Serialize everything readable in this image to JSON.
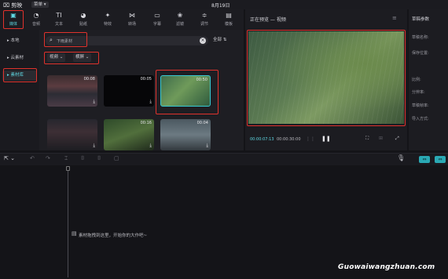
{
  "titlebar": {
    "app_name": "剪映",
    "menu_label": "菜单",
    "menu_arrow": "▾",
    "date": "8月19日"
  },
  "toolbar": {
    "items": [
      {
        "label": "媒体",
        "icon": "media-icon",
        "glyph": "▣"
      },
      {
        "label": "音频",
        "icon": "audio-icon",
        "glyph": "◔"
      },
      {
        "label": "文本",
        "icon": "text-icon",
        "glyph": "TI"
      },
      {
        "label": "贴纸",
        "icon": "sticker-icon",
        "glyph": "◕"
      },
      {
        "label": "特效",
        "icon": "effects-icon",
        "glyph": "✦"
      },
      {
        "label": "转场",
        "icon": "transition-icon",
        "glyph": "⋈"
      },
      {
        "label": "字幕",
        "icon": "subtitle-icon",
        "glyph": "▭"
      },
      {
        "label": "滤镜",
        "icon": "filter-icon",
        "glyph": "❀"
      },
      {
        "label": "调节",
        "icon": "adjust-icon",
        "glyph": "≑"
      },
      {
        "label": "模板",
        "icon": "template-icon",
        "glyph": "▤"
      }
    ]
  },
  "leftnav": {
    "items": [
      {
        "label": "▸ 本地"
      },
      {
        "label": "▸ 云素材"
      },
      {
        "label": "▸ 素材库"
      }
    ]
  },
  "media": {
    "search_placeholder": "下雨素材",
    "sort_label": "全部",
    "filter_icon": "⇅",
    "dropdown_video": "视频",
    "dropdown_aspect": "横屏",
    "thumbs": [
      {
        "duration": "00:08"
      },
      {
        "duration": "00:05"
      },
      {
        "duration": "00:50"
      },
      {
        "duration": ""
      },
      {
        "duration": "00:16"
      },
      {
        "duration": "00:04"
      }
    ]
  },
  "preview": {
    "title": "正在预览 — 视频",
    "time_current": "00:00:07:13",
    "time_total": "00:00:30:00"
  },
  "draft": {
    "title": "草稿参数",
    "fields": [
      "草稿名称:",
      "保存位置:",
      "比例:",
      "分辨率:",
      "草稿帧率:",
      "导入方式:"
    ]
  },
  "timeline": {
    "empty_message": "素材拖拽到这里，开始你的大作吧~"
  },
  "watermark": "Guowaiwangzhuan.com",
  "colors": {
    "accent": "#5fd9e4",
    "highlight": "#e0322c",
    "background": "#141418"
  }
}
